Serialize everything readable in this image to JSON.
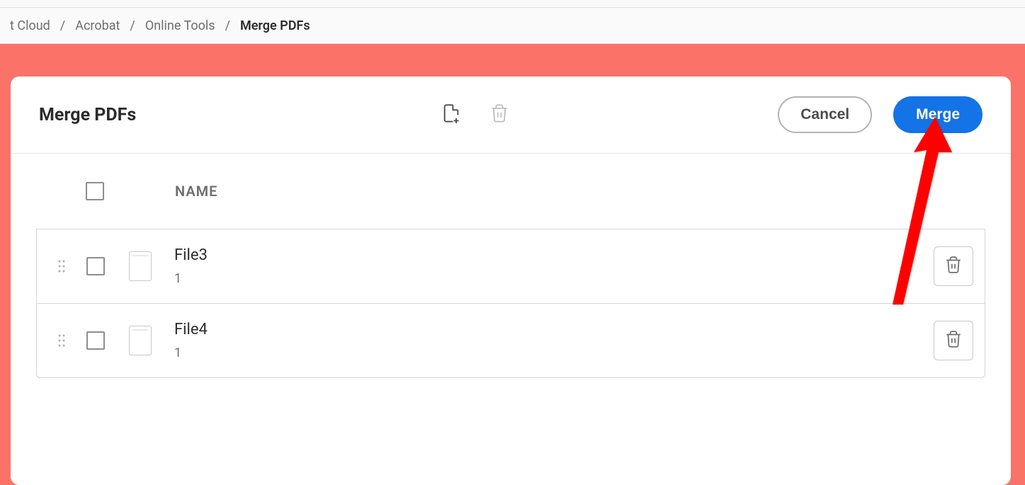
{
  "breadcrumb": {
    "items": [
      "t Cloud",
      "Acrobat",
      "Online Tools"
    ],
    "current": "Merge PDFs"
  },
  "panel": {
    "title": "Merge PDFs"
  },
  "actions": {
    "cancel_label": "Cancel",
    "merge_label": "Merge"
  },
  "table": {
    "name_header": "NAME"
  },
  "files": [
    {
      "name": "File3",
      "pages": "1"
    },
    {
      "name": "File4",
      "pages": "1"
    }
  ]
}
